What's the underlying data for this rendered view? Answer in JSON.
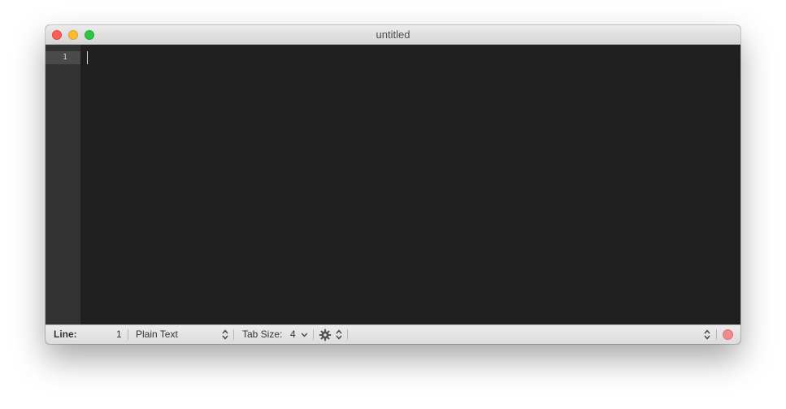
{
  "window": {
    "title": "untitled"
  },
  "editor": {
    "line_numbers": [
      "1"
    ]
  },
  "statusbar": {
    "line_label": "Line:",
    "line_value": "1",
    "language": "Plain Text",
    "tab_size_label": "Tab Size:",
    "tab_size_value": "4"
  },
  "colors": {
    "editor_bg": "#202020",
    "gutter_bg": "#333333",
    "record_button": "#f08c89"
  }
}
